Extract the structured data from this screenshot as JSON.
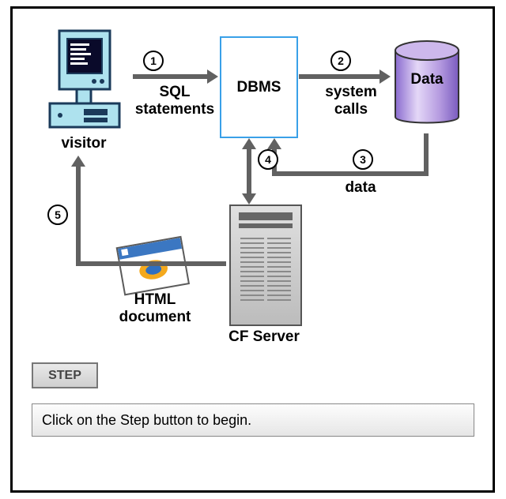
{
  "nodes": {
    "visitor": "visitor",
    "dbms": "DBMS",
    "data": "Data",
    "cfserver": "CF Server",
    "html_doc_l1": "HTML",
    "html_doc_l2": "document"
  },
  "arrows": {
    "a1_num": "1",
    "a1_text_l1": "SQL",
    "a1_text_l2": "statements",
    "a2_num": "2",
    "a2_text_l1": "system",
    "a2_text_l2": "calls",
    "a3_num": "3",
    "a3_text": "data",
    "a4_num": "4",
    "a5_num": "5"
  },
  "controls": {
    "step": "STEP"
  },
  "message": "Click on the Step button to begin."
}
